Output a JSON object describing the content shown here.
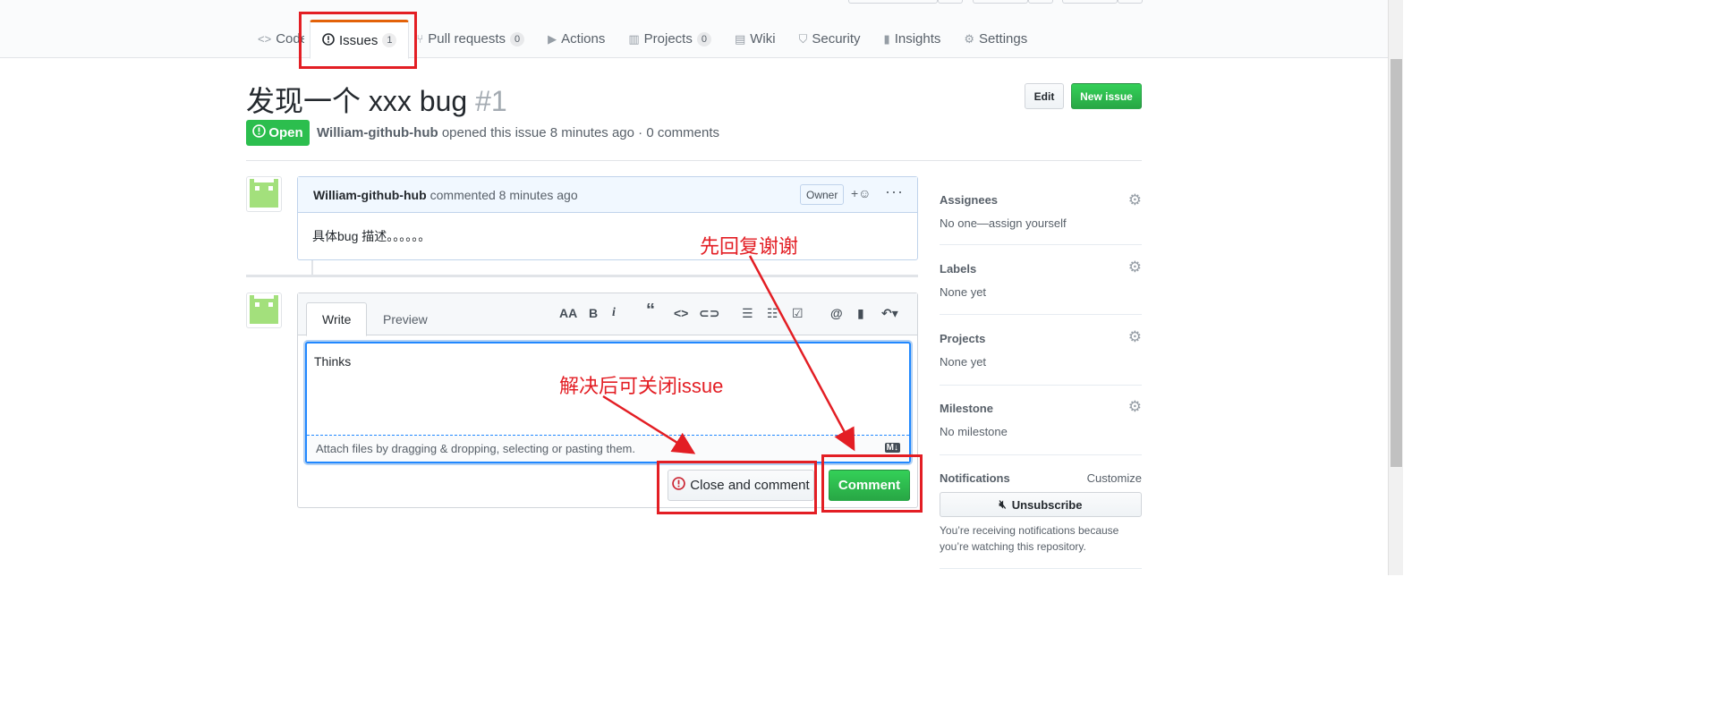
{
  "repo_nav": {
    "tabs": [
      {
        "label": "Code",
        "icon": "code-icon",
        "counter": ""
      },
      {
        "label": "Issues",
        "icon": "issue-opened-icon",
        "counter": "1"
      },
      {
        "label": "Pull requests",
        "icon": "git-pull-request-icon",
        "counter": "0"
      },
      {
        "label": "Actions",
        "icon": "play-icon",
        "counter": ""
      },
      {
        "label": "Projects",
        "icon": "project-icon",
        "counter": "0"
      },
      {
        "label": "Wiki",
        "icon": "book-icon",
        "counter": ""
      },
      {
        "label": "Security",
        "icon": "shield-icon",
        "counter": ""
      },
      {
        "label": "Insights",
        "icon": "graph-icon",
        "counter": ""
      },
      {
        "label": "Settings",
        "icon": "gear-icon",
        "counter": ""
      }
    ]
  },
  "issue": {
    "title": "发现一个 xxx bug",
    "number": "#1",
    "edit_label": "Edit",
    "new_issue_label": "New issue",
    "state": "Open",
    "author": "William-github-hub",
    "meta_text": "opened this issue 8 minutes ago · 0 comments"
  },
  "comment": {
    "author": "William-github-hub",
    "meta": "commented 8 minutes ago",
    "owner_badge": "Owner",
    "body": "具体bug 描述。。。。。。"
  },
  "new_comment": {
    "write_tab": "Write",
    "preview_tab": "Preview",
    "text_value": "Thinks",
    "attach_hint": "Attach files by dragging & dropping, selecting or pasting them.",
    "close_button": "Close and comment",
    "comment_button": "Comment",
    "markdown_badge": "M↓"
  },
  "annotations": {
    "reply_first": "先回复谢谢",
    "close_after": "解决后可关闭issue",
    "color": "#e31e24"
  },
  "sidebar": {
    "assignees": {
      "title": "Assignees",
      "value": "No one—assign yourself"
    },
    "labels": {
      "title": "Labels",
      "value": "None yet"
    },
    "projects": {
      "title": "Projects",
      "value": "None yet"
    },
    "milestone": {
      "title": "Milestone",
      "value": "No milestone"
    },
    "notifications": {
      "title": "Notifications",
      "customize": "Customize",
      "unsubscribe": "Unsubscribe",
      "text": "You’re receiving notifications because you’re watching this repository."
    }
  },
  "colors": {
    "open_green": "#2cbe4e",
    "button_green": "#28a745",
    "selected_tab_accent": "#e36209"
  }
}
